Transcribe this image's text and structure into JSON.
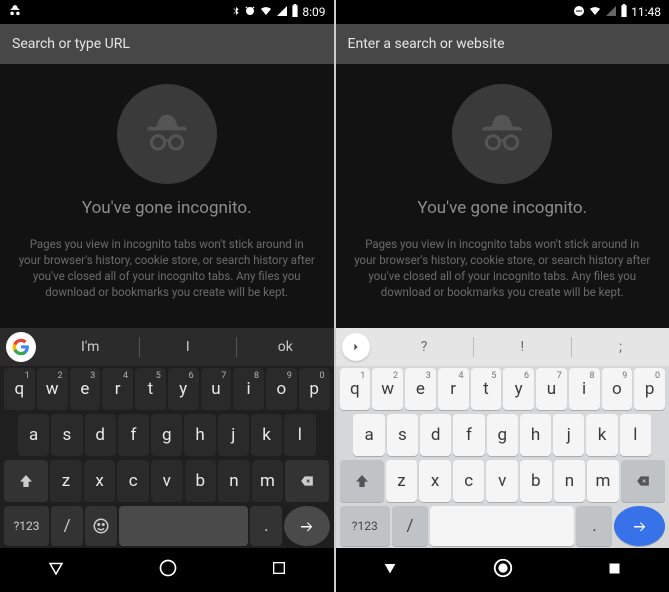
{
  "left": {
    "status_time": "8:09",
    "url_placeholder": "Search or type URL",
    "heading": "You've gone incognito.",
    "body": "Pages you view in incognito tabs won't stick around in your browser's history, cookie store, or search history after you've closed all of your incognito tabs. Any files you download or bookmarks you create will be kept.",
    "suggestions": [
      "I'm",
      "I",
      "ok"
    ],
    "row1_nums": [
      "1",
      "2",
      "3",
      "4",
      "5",
      "6",
      "7",
      "8",
      "9",
      "0"
    ],
    "row1": [
      "q",
      "w",
      "e",
      "r",
      "t",
      "y",
      "u",
      "i",
      "o",
      "p"
    ],
    "row2": [
      "a",
      "s",
      "d",
      "f",
      "g",
      "h",
      "j",
      "k",
      "l"
    ],
    "row3": [
      "z",
      "x",
      "c",
      "v",
      "b",
      "n",
      "m"
    ],
    "symkey": "?123",
    "slash": "/",
    "period": "."
  },
  "right": {
    "status_time": "11:48",
    "url_placeholder": "Enter a search or website",
    "heading": "You've gone incognito.",
    "body": "Pages you view in incognito tabs won't stick around in your browser's history, cookie store, or search history after you've closed all of your incognito tabs. Any files you download or bookmarks you create will be kept.",
    "suggestions": [
      "?",
      "!",
      ";"
    ],
    "row1_nums": [
      "1",
      "2",
      "3",
      "4",
      "5",
      "6",
      "7",
      "8",
      "9",
      "0"
    ],
    "row1": [
      "q",
      "w",
      "e",
      "r",
      "t",
      "y",
      "u",
      "i",
      "o",
      "p"
    ],
    "row2": [
      "a",
      "s",
      "d",
      "f",
      "g",
      "h",
      "j",
      "k",
      "l"
    ],
    "row3": [
      "z",
      "x",
      "c",
      "v",
      "b",
      "n",
      "m"
    ],
    "symkey": "?123",
    "slash": "/",
    "period": "."
  }
}
